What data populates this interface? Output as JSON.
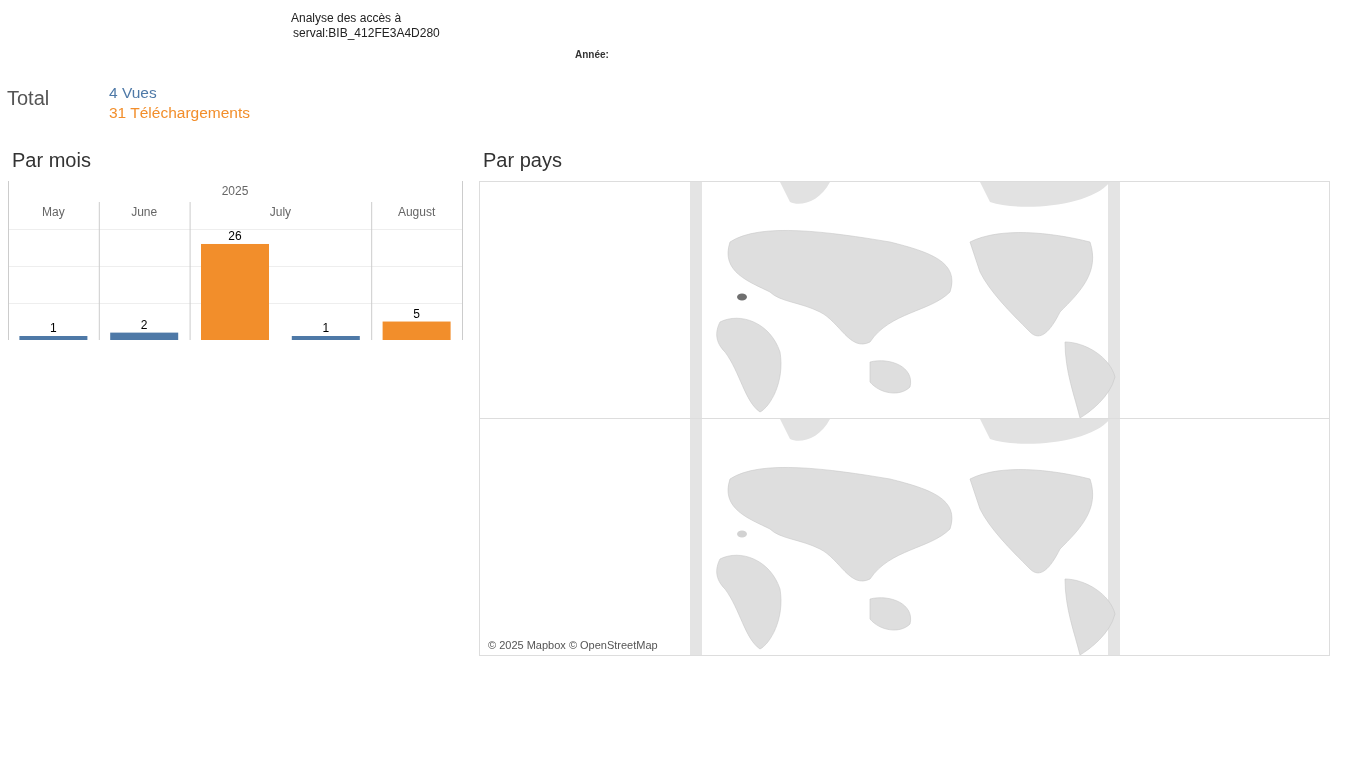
{
  "header": {
    "title_lines": [
      "Analyse des accès à",
      "serval:BIB_412FE3A4D280"
    ],
    "year_filter_label": "Année:"
  },
  "total": {
    "label": "Total",
    "metrics": [
      {
        "text": "4 Vues",
        "color": "#4e79a7"
      },
      {
        "text": "31 Téléchargements",
        "color": "#f28e2b"
      }
    ]
  },
  "par_mois": {
    "title": "Par mois",
    "year_header": "2025",
    "chart_data": {
      "type": "bar",
      "categories": [
        "May",
        "June",
        "July",
        "August"
      ],
      "series": [
        {
          "color": "#f28e2b",
          "values": [
            null,
            null,
            26,
            5
          ]
        },
        {
          "color": "#4e79a7",
          "values": [
            1,
            2,
            1,
            null
          ]
        }
      ],
      "data_labels": true
    }
  },
  "par_pays": {
    "title": "Par pays",
    "maps": [
      {
        "highlighted_country": true
      },
      {
        "highlighted_country": false
      }
    ],
    "attribution": "© 2025 Mapbox © OpenStreetMap"
  }
}
